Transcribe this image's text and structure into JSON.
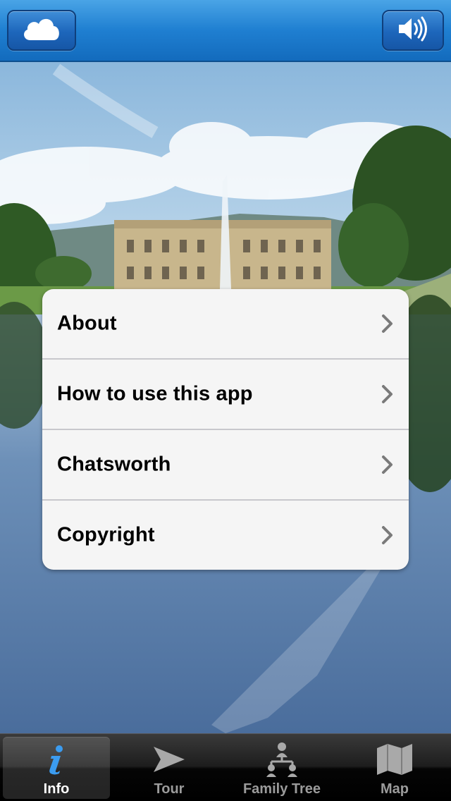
{
  "navbar": {
    "left_icon": "cloud-icon",
    "right_icon": "speaker-icon"
  },
  "menu": {
    "items": [
      {
        "label": "About"
      },
      {
        "label": "How to use this app"
      },
      {
        "label": "Chatsworth"
      },
      {
        "label": "Copyright"
      }
    ]
  },
  "tabbar": {
    "active_tab": "Info",
    "tabs": [
      {
        "label": "Info",
        "icon": "info-icon"
      },
      {
        "label": "Tour",
        "icon": "tour-arrow-icon"
      },
      {
        "label": "Family Tree",
        "icon": "family-tree-icon"
      },
      {
        "label": "Map",
        "icon": "map-icon"
      }
    ]
  },
  "colors": {
    "navbar": "#1f7fd1",
    "menu_background": "#f5f5f5",
    "tab_active_label": "#ffffff",
    "tab_inactive_label": "#9b9b9b",
    "info_icon": "#2f8fe6"
  }
}
